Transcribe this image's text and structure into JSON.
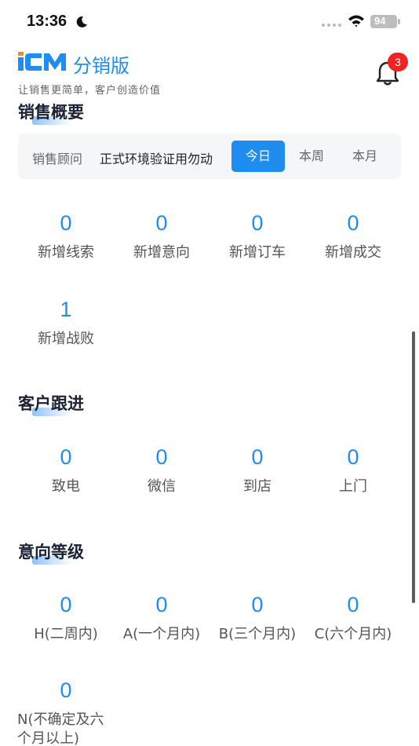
{
  "status_bar": {
    "time": "13:36",
    "battery": "94"
  },
  "header": {
    "logo_text": "ICM",
    "app_title": "分销版",
    "slogan": "让销售更简单，客户创造价值",
    "notification_count": "3"
  },
  "sales_overview": {
    "title": "销售概要",
    "filter": {
      "label": "销售顾问",
      "value": "正式环境验证用勿动",
      "tabs": [
        "今日",
        "本周",
        "本月"
      ],
      "active_tab": "今日"
    },
    "stats": [
      {
        "value": "0",
        "label": "新增线索"
      },
      {
        "value": "0",
        "label": "新增意向"
      },
      {
        "value": "0",
        "label": "新增订车"
      },
      {
        "value": "0",
        "label": "新增成交"
      },
      {
        "value": "1",
        "label": "新增战败"
      }
    ]
  },
  "customer_followup": {
    "title": "客户跟进",
    "stats": [
      {
        "value": "0",
        "label": "致电"
      },
      {
        "value": "0",
        "label": "微信"
      },
      {
        "value": "0",
        "label": "到店"
      },
      {
        "value": "0",
        "label": "上门"
      }
    ]
  },
  "intent_level": {
    "title": "意向等级",
    "stats": [
      {
        "value": "0",
        "label": "H(二周内)"
      },
      {
        "value": "0",
        "label": "A(一个月内)"
      },
      {
        "value": "0",
        "label": "B(三个月内)"
      },
      {
        "value": "0",
        "label": "C(六个月内)"
      },
      {
        "value": "0",
        "label": "N(不确定及六个月以上)"
      }
    ]
  },
  "colors": {
    "accent": "#1f8cf0",
    "badge": "#ee2323",
    "filter_bg": "#f4f6f8"
  },
  "icons": [
    "moon-icon",
    "wifi-icon",
    "battery-icon",
    "bell-icon"
  ]
}
